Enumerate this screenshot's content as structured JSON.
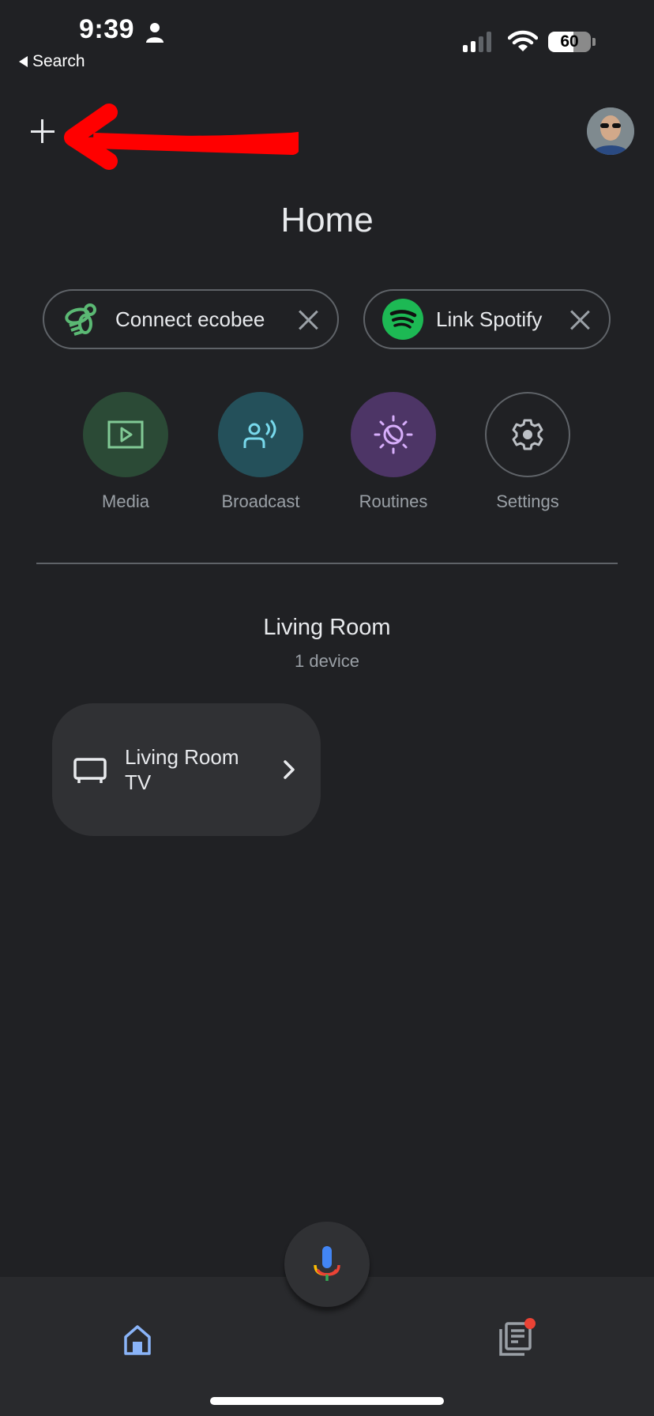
{
  "status_bar": {
    "time": "9:39",
    "back_label": "Search",
    "battery_percent": 60,
    "battery_text": "60",
    "signal_bars_active": 2,
    "signal_bars_total": 4,
    "icons": [
      "person-icon",
      "cellular-signal-icon",
      "wifi-icon",
      "battery-icon"
    ]
  },
  "header": {
    "add_icon": "plus-icon",
    "annotation": "red-arrow-pointing-left",
    "avatar": "user-avatar",
    "title": "Home"
  },
  "chips": [
    {
      "label": "Connect ecobee",
      "icon": "ecobee-bee-icon",
      "icon_color": "#5bb974",
      "close_icon": "close-icon"
    },
    {
      "label": "Link Spotify",
      "icon": "spotify-icon",
      "icon_color": "#1db954",
      "close_icon": "close-icon"
    }
  ],
  "actions": [
    {
      "label": "Media",
      "icon": "play-screen-icon",
      "bg": "#2b4a36",
      "fg": "#81c995"
    },
    {
      "label": "Broadcast",
      "icon": "broadcast-person-icon",
      "bg": "#24505a",
      "fg": "#78d9ec"
    },
    {
      "label": "Routines",
      "icon": "sun-moon-icon",
      "bg": "#4d3566",
      "fg": "#d7aefb"
    },
    {
      "label": "Settings",
      "icon": "gear-icon",
      "bg": "transparent",
      "fg": "#bdc1c6"
    }
  ],
  "room": {
    "name": "Living Room",
    "device_count": "1 device",
    "devices": [
      {
        "name": "Living Room TV",
        "icon": "tv-icon"
      }
    ]
  },
  "bottom_nav": {
    "mic_icon": "google-mic-icon",
    "home_icon": "home-icon",
    "feed_icon": "feed-icon",
    "feed_badge": true,
    "accent": "#8ab4f8"
  }
}
